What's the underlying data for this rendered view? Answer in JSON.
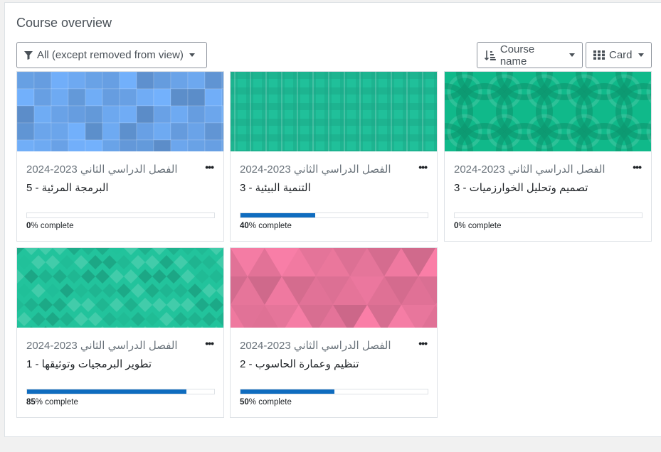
{
  "block": {
    "title": "Course overview"
  },
  "filter": {
    "label": "All (except removed from view)"
  },
  "sort": {
    "label": "Course name"
  },
  "view": {
    "label": "Card"
  },
  "courses": [
    {
      "category": "الفصل الدراسي الثاني 2023-2024",
      "name": "البرمجة المرئية - 5",
      "progress": 0,
      "pct": "0",
      "pct_suffix": "% complete",
      "pattern": "squares",
      "color": "#74b3ff"
    },
    {
      "category": "الفصل الدراسي الثاني 2023-2024",
      "name": "التنمية البيئية - 3",
      "progress": 40,
      "pct": "40",
      "pct_suffix": "% complete",
      "pattern": "plaid",
      "color": "#20c09a"
    },
    {
      "category": "الفصل الدراسي الثاني 2023-2024",
      "name": "تصميم وتحليل الخوارزميات - 3",
      "progress": 0,
      "pct": "0",
      "pct_suffix": "% complete",
      "pattern": "circles",
      "color": "#10b98a"
    },
    {
      "category": "الفصل الدراسي الثاني 2023-2024",
      "name": "تطوير البرمجيات وتوثيقها - 1",
      "progress": 85,
      "pct": "85",
      "pct_suffix": "% complete",
      "pattern": "diamonds",
      "color": "#22c39c"
    },
    {
      "category": "الفصل الدراسي الثاني 2023-2024",
      "name": "تنظيم وعمارة الحاسوب - 2",
      "progress": 50,
      "pct": "50",
      "pct_suffix": "% complete",
      "pattern": "triangles",
      "color": "#fa7fa8"
    }
  ],
  "icons": {
    "filter": "funnel-icon",
    "sort": "sort-amount-icon",
    "view": "grid-icon",
    "menu": "ellipsis-icon",
    "dropdown": "caret-down-icon"
  }
}
